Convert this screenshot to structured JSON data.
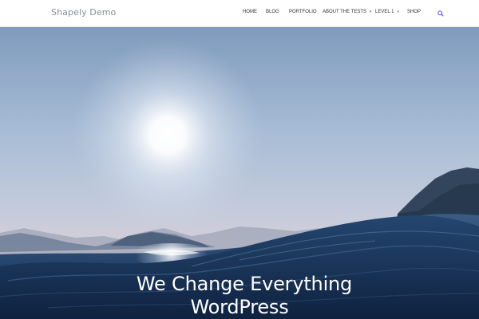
{
  "header": {
    "site_title": "Shapely Demo",
    "nav": [
      {
        "label": "HOME",
        "has_submenu": false
      },
      {
        "label": "BLOG",
        "has_submenu": false
      },
      {
        "label": "PORTFOLIO",
        "has_submenu": false
      },
      {
        "label": "ABOUT THE TESTS",
        "has_submenu": true
      },
      {
        "label": "LEVEL 1",
        "has_submenu": true
      },
      {
        "label": "SHOP",
        "has_submenu": false
      }
    ],
    "submenu_caret": "▾",
    "search_icon": "search-icon",
    "accent_color": "#745cf9"
  },
  "hero": {
    "title_line1": "We Change Everything",
    "title_line2": "WordPress",
    "image": "sunlit-ocean-waves-icon"
  }
}
